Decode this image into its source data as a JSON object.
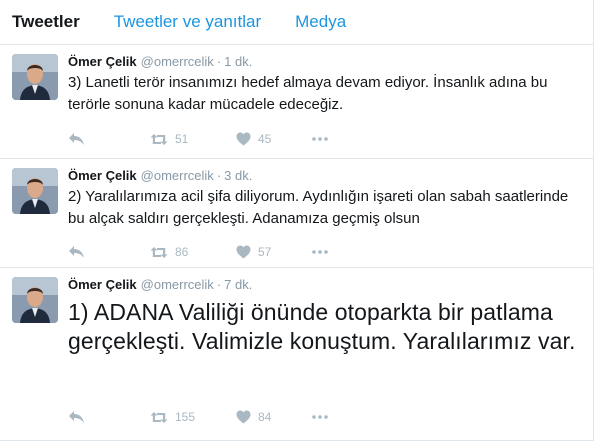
{
  "tabs": [
    {
      "label": "Tweetler",
      "active": true
    },
    {
      "label": "Tweetler ve yanıtlar",
      "active": false
    },
    {
      "label": "Medya",
      "active": false
    }
  ],
  "tweets": [
    {
      "name": "Ömer Çelik",
      "handle": "@omerrcelik",
      "separator": "·",
      "time": "1 dk.",
      "text": "3) Lanetli terör insanımızı hedef almaya devam ediyor. İnsanlık adına bu terörle sonuna kadar mücadele edeceğiz.",
      "retweets": "51",
      "likes": "45"
    },
    {
      "name": "Ömer Çelik",
      "handle": "@omerrcelik",
      "separator": "·",
      "time": "3 dk.",
      "text": "2) Yaralılarımıza acil şifa diliyorum. Aydınlığın işareti olan sabah saatlerinde bu alçak saldırı gerçekleşti. Adanamıza geçmiş olsun",
      "retweets": "86",
      "likes": "57"
    },
    {
      "name": "Ömer Çelik",
      "handle": "@omerrcelik",
      "separator": "·",
      "time": "7 dk.",
      "text": "1) ADANA Valiliği önünde otoparkta  bir patlama gerçekleşti. Valimizle konuştum. Yaralılarımız var.",
      "retweets": "155",
      "likes": "84"
    }
  ],
  "colors": {
    "accent": "#1b95e0",
    "text": "#14171a",
    "muted": "#8899a6",
    "icon": "#aab8c2",
    "border": "#e1e8ed"
  },
  "icons": {
    "reply": "reply-icon",
    "retweet": "retweet-icon",
    "like": "heart-icon",
    "more": "more-icon"
  }
}
